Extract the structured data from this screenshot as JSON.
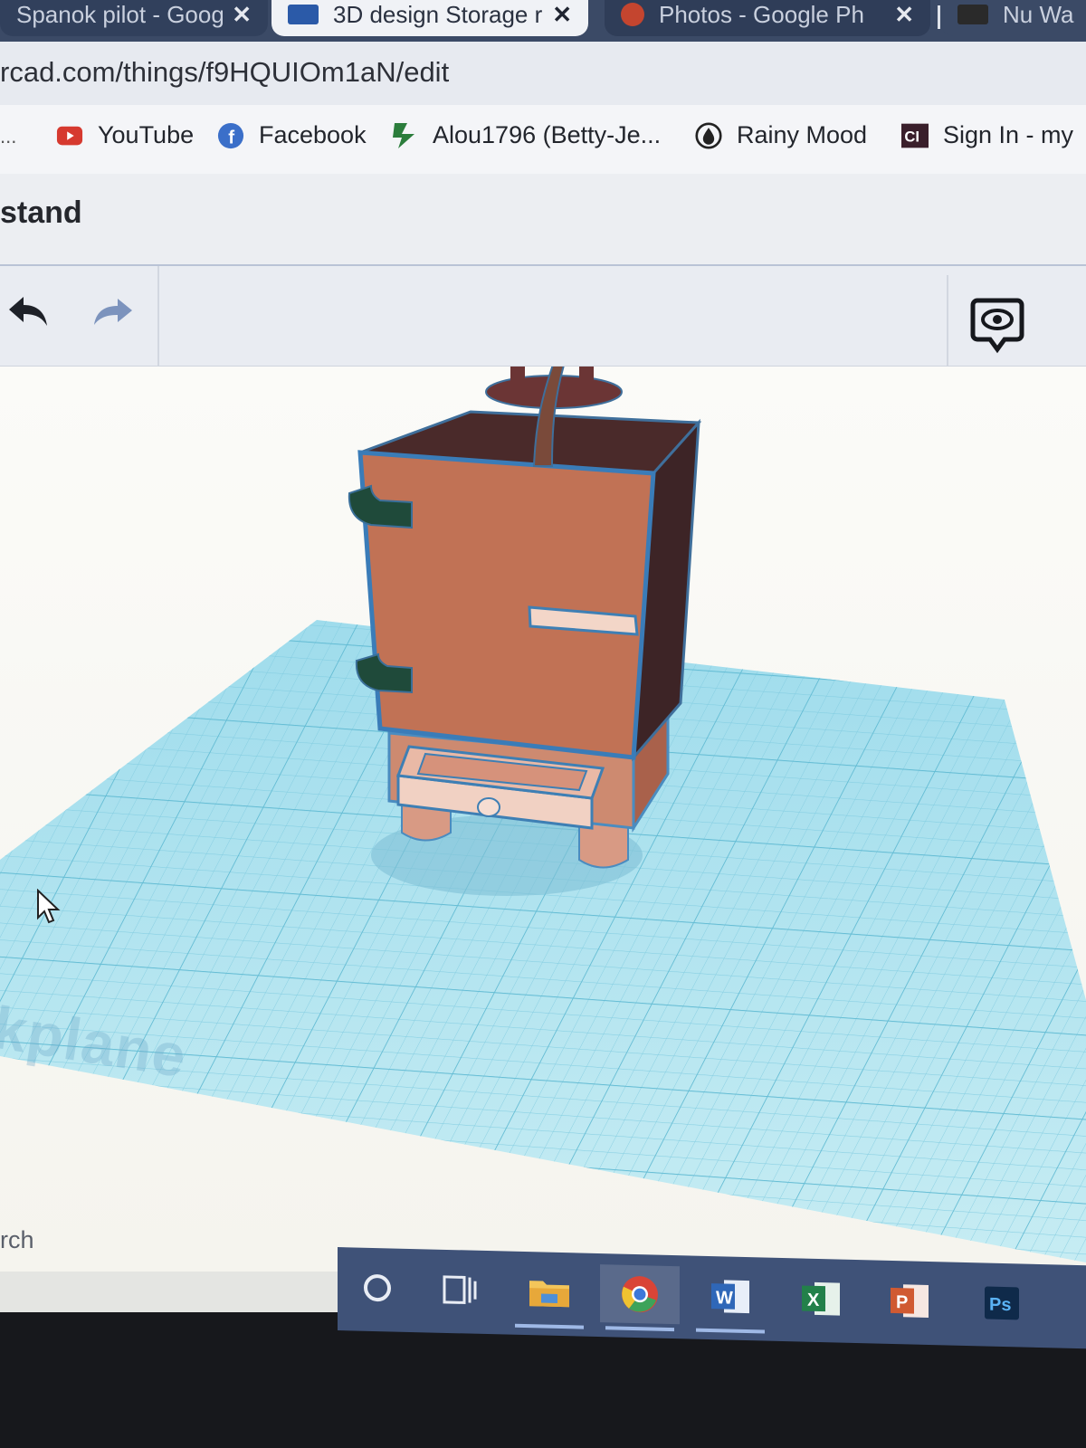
{
  "browser": {
    "tabs": [
      {
        "label": "Spanok pilot - Goog",
        "close": "✕"
      },
      {
        "label": "3D design Storage r",
        "close": "✕"
      },
      {
        "label": "Photos - Google Ph",
        "close": "✕"
      },
      {
        "label": "Nu Wa"
      }
    ],
    "url": "rcad.com/things/f9HQUIOm1aN/edit",
    "bookmarks": {
      "overflow": "...",
      "items": [
        {
          "label": "YouTube",
          "icon": "youtube-icon"
        },
        {
          "label": "Facebook",
          "icon": "facebook-icon"
        },
        {
          "label": "Alou1796 (Betty-Je...",
          "icon": "puzzle-icon"
        },
        {
          "label": "Rainy Mood",
          "icon": "raindrop-icon"
        },
        {
          "label": "Sign In - my",
          "icon": "ci-logo-icon"
        }
      ]
    }
  },
  "editor": {
    "design_title": "stand",
    "toolbar": {
      "undo_icon": "undo-icon",
      "redo_icon": "redo-icon",
      "view_icon": "eye-speech-icon"
    },
    "workplane_label": "kplane",
    "colors": {
      "workplane": "#aee3ee",
      "cabinet": "#c4755a",
      "hinges": "#1f4a3a"
    }
  },
  "taskbar": {
    "search_hint": "rch",
    "apps": [
      {
        "name": "cortana",
        "icon": "circle-icon"
      },
      {
        "name": "task-view",
        "icon": "task-view-icon"
      },
      {
        "name": "file-explorer",
        "icon": "folder-icon"
      },
      {
        "name": "chrome",
        "icon": "chrome-icon"
      },
      {
        "name": "word",
        "icon": "word-icon",
        "glyph": "W"
      },
      {
        "name": "excel",
        "icon": "excel-icon",
        "glyph": "X"
      },
      {
        "name": "powerpoint",
        "icon": "powerpoint-icon",
        "glyph": "P"
      },
      {
        "name": "photoshop",
        "icon": "photoshop-icon",
        "glyph": "Ps"
      }
    ]
  }
}
